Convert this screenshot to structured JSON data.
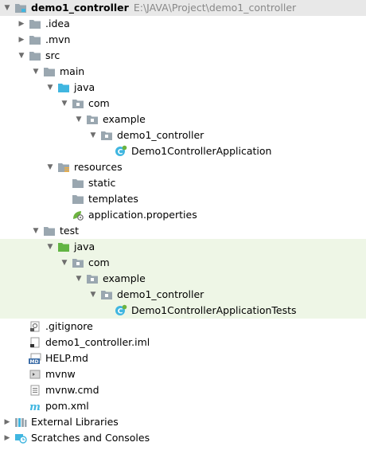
{
  "project": {
    "name": "demo1_controller",
    "path": "E:\\JAVA\\Project\\demo1_controller"
  },
  "tree": [
    {
      "name": "idea-folder",
      "label": ".idea",
      "indent": 1,
      "arrow": "right",
      "icon": "folder",
      "interactable": true
    },
    {
      "name": "mvn-folder",
      "label": ".mvn",
      "indent": 1,
      "arrow": "right",
      "icon": "folder",
      "interactable": true
    },
    {
      "name": "src-folder",
      "label": "src",
      "indent": 1,
      "arrow": "down",
      "icon": "folder",
      "interactable": true
    },
    {
      "name": "main-folder",
      "label": "main",
      "indent": 2,
      "arrow": "down",
      "icon": "folder",
      "interactable": true
    },
    {
      "name": "main-java-folder",
      "label": "java",
      "indent": 3,
      "arrow": "down",
      "icon": "source-folder",
      "interactable": true
    },
    {
      "name": "main-com-package",
      "label": "com",
      "indent": 4,
      "arrow": "down",
      "icon": "package",
      "interactable": true
    },
    {
      "name": "main-example-package",
      "label": "example",
      "indent": 5,
      "arrow": "down",
      "icon": "package",
      "interactable": true
    },
    {
      "name": "main-demo1-controller-package",
      "label": "demo1_controller",
      "indent": 6,
      "arrow": "down",
      "icon": "package",
      "interactable": true
    },
    {
      "name": "demo1-controller-application-file",
      "label": "Demo1ControllerApplication",
      "indent": 7,
      "arrow": "none",
      "icon": "spring-class",
      "interactable": true
    },
    {
      "name": "resources-folder",
      "label": "resources",
      "indent": 3,
      "arrow": "down",
      "icon": "resources-folder",
      "interactable": true
    },
    {
      "name": "static-folder",
      "label": "static",
      "indent": 4,
      "arrow": "none",
      "icon": "folder",
      "interactable": true
    },
    {
      "name": "templates-folder",
      "label": "templates",
      "indent": 4,
      "arrow": "none",
      "icon": "folder",
      "interactable": true
    },
    {
      "name": "application-properties-file",
      "label": "application.properties",
      "indent": 4,
      "arrow": "none",
      "icon": "properties",
      "interactable": true
    },
    {
      "name": "test-folder",
      "label": "test",
      "indent": 2,
      "arrow": "down",
      "icon": "folder",
      "interactable": true
    },
    {
      "name": "test-java-folder",
      "label": "java",
      "indent": 3,
      "arrow": "down",
      "icon": "test-folder",
      "interactable": true,
      "test": true
    },
    {
      "name": "test-com-package",
      "label": "com",
      "indent": 4,
      "arrow": "down",
      "icon": "package",
      "interactable": true,
      "test": true
    },
    {
      "name": "test-example-package",
      "label": "example",
      "indent": 5,
      "arrow": "down",
      "icon": "package",
      "interactable": true,
      "test": true
    },
    {
      "name": "test-demo1-controller-package",
      "label": "demo1_controller",
      "indent": 6,
      "arrow": "down",
      "icon": "package",
      "interactable": true,
      "test": true
    },
    {
      "name": "demo1-controller-application-tests-file",
      "label": "Demo1ControllerApplicationTests",
      "indent": 7,
      "arrow": "none",
      "icon": "spring-class",
      "interactable": true,
      "test": true
    },
    {
      "name": "gitignore-file",
      "label": ".gitignore",
      "indent": 1,
      "arrow": "none",
      "icon": "gitignore",
      "interactable": true
    },
    {
      "name": "iml-file",
      "label": "demo1_controller.iml",
      "indent": 1,
      "arrow": "none",
      "icon": "iml",
      "interactable": true
    },
    {
      "name": "help-md-file",
      "label": "HELP.md",
      "indent": 1,
      "arrow": "none",
      "icon": "markdown",
      "interactable": true
    },
    {
      "name": "mvnw-file",
      "label": "mvnw",
      "indent": 1,
      "arrow": "none",
      "icon": "script",
      "interactable": true
    },
    {
      "name": "mvnw-cmd-file",
      "label": "mvnw.cmd",
      "indent": 1,
      "arrow": "none",
      "icon": "text-file",
      "interactable": true
    },
    {
      "name": "pom-xml-file",
      "label": "pom.xml",
      "indent": 1,
      "arrow": "none",
      "icon": "maven",
      "interactable": true
    },
    {
      "name": "external-libraries",
      "label": "External Libraries",
      "indent": 0,
      "arrow": "right",
      "icon": "libraries",
      "interactable": true
    },
    {
      "name": "scratches-and-consoles",
      "label": "Scratches and Consoles",
      "indent": 0,
      "arrow": "right",
      "icon": "scratches",
      "interactable": true
    }
  ]
}
